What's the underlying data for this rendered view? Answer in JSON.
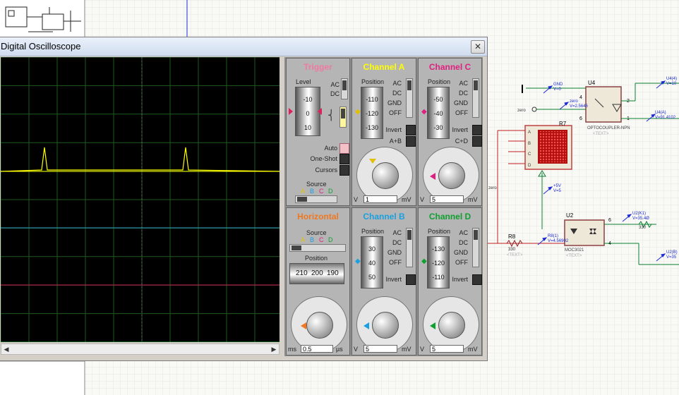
{
  "window": {
    "title": "Digital Oscilloscope",
    "close_glyph": "✕"
  },
  "colors": {
    "trigger": "#f07aa0",
    "channel_a": "#ffff00",
    "channel_b": "#1aa0e0",
    "channel_c": "#e02080",
    "channel_d": "#10a030",
    "horizontal": "#f07820"
  },
  "trigger": {
    "title": "Trigger",
    "level_label": "Level",
    "level_ticks": [
      "-10",
      "0",
      "10"
    ],
    "ac": "AC",
    "dc": "DC",
    "auto": "Auto",
    "one_shot": "One-Shot",
    "cursors": "Cursors",
    "source_label": "Source",
    "source_letters": [
      "A",
      "B",
      "C",
      "D"
    ]
  },
  "horizontal": {
    "title": "Horizontal",
    "source_label": "Source",
    "source_letters": [
      "A",
      "B",
      "C",
      "D"
    ],
    "position_label": "Position",
    "position_ticks": [
      "210",
      "200",
      "190"
    ],
    "unit_left": "ms",
    "unit_right": "µs",
    "value": "0.5",
    "dial_labels": [
      "0.5",
      "0.2",
      "0.1",
      "50",
      "20",
      "10",
      "5",
      "2",
      "1",
      "0.5",
      "0.2",
      "0.1",
      "50",
      "20",
      "10",
      "5",
      "2",
      "1",
      "200",
      "100"
    ]
  },
  "channels": {
    "a": {
      "title": "Channel A",
      "position_label": "Position",
      "ticks": [
        "-110",
        "-120",
        "-130"
      ],
      "coupling": [
        "AC",
        "DC",
        "GND",
        "OFF"
      ],
      "invert": "Invert",
      "extra": "A+B",
      "unit_left": "V",
      "unit_right": "mV",
      "value": "1",
      "dial_labels": [
        "0.5",
        "0.2",
        "0.1",
        "50",
        "20",
        "10",
        "5",
        "2",
        "1",
        "2",
        "5",
        "10",
        "20"
      ]
    },
    "c": {
      "title": "Channel C",
      "position_label": "Position",
      "ticks": [
        "-50",
        "-40",
        "-30"
      ],
      "coupling": [
        "AC",
        "DC",
        "GND",
        "OFF"
      ],
      "invert": "Invert",
      "extra": "C+D",
      "unit_left": "V",
      "unit_right": "mV",
      "value": "5",
      "dial_labels": [
        "0.5",
        "0.2",
        "0.1",
        "50",
        "20",
        "10",
        "5",
        "2",
        "1",
        "2",
        "5",
        "10",
        "20"
      ]
    },
    "b": {
      "title": "Channel B",
      "position_label": "Position",
      "ticks": [
        "30",
        "40",
        "50"
      ],
      "coupling": [
        "AC",
        "DC",
        "GND",
        "OFF"
      ],
      "invert": "Invert",
      "unit_left": "V",
      "unit_right": "mV",
      "value": "5",
      "dial_labels": [
        "0.5",
        "0.2",
        "0.1",
        "50",
        "20",
        "10",
        "5",
        "2",
        "1",
        "2",
        "5",
        "10",
        "20"
      ]
    },
    "d": {
      "title": "Channel D",
      "position_label": "Position",
      "ticks": [
        "-130",
        "-120",
        "-110"
      ],
      "coupling": [
        "AC",
        "DC",
        "GND",
        "OFF"
      ],
      "invert": "Invert",
      "unit_left": "V",
      "unit_right": "mV",
      "value": "5",
      "dial_labels": [
        "0.5",
        "0.2",
        "0.1",
        "50",
        "20",
        "10",
        "5",
        "2",
        "1",
        "2",
        "5",
        "10",
        "20"
      ]
    }
  },
  "schematic": {
    "u4": {
      "ref": "U4",
      "part": "OPTOCOUPLER-NPN",
      "text": "<TEXT>"
    },
    "u2": {
      "ref": "U2",
      "part": "MOC3021",
      "text": "<TEXT>"
    },
    "r7": {
      "ref": "R7",
      "text": "<TEXT>"
    },
    "r8": {
      "ref": "R8",
      "value": "330",
      "text": "<TEXT>"
    },
    "probes": {
      "gnd": {
        "name": "GND",
        "value": "V=0"
      },
      "zero": {
        "name": "zero",
        "value": "V=2.5646"
      },
      "u4_4": {
        "name": "U4(4)",
        "value": "V=10"
      },
      "u4_a": {
        "name": "U4(A)",
        "value": "V=91.4102"
      },
      "plus5v": {
        "name": "+5V",
        "value": "V=5"
      },
      "r8_1": {
        "name": "R8(1)",
        "value": "V=4.56902"
      },
      "u2_k1": {
        "name": "U2(K1)",
        "value": "V=35.4Ø"
      },
      "u2_b": {
        "name": "U2(B)",
        "value": "V=35"
      }
    },
    "net_zero": "zero",
    "pins": [
      "A",
      "B",
      "C",
      "D"
    ],
    "resistor_330": "330"
  }
}
